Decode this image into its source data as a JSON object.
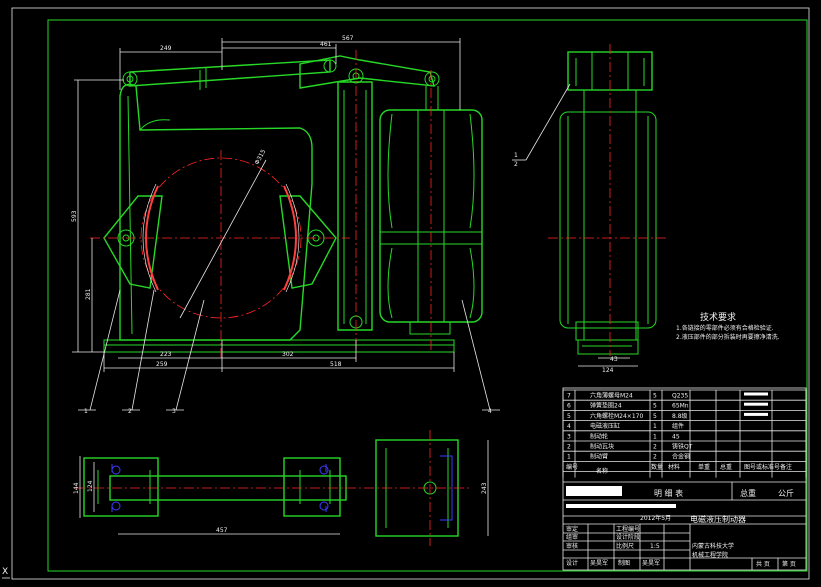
{
  "dimensions": {
    "d249": "249",
    "d461": "461",
    "d567": "567",
    "d593": "593",
    "d281": "281",
    "d223": "223",
    "d302": "302",
    "d259": "259",
    "d518": "518",
    "d315": "Φ315",
    "d43": "43",
    "d124": "124",
    "d144": "144",
    "d124b": "124",
    "d457": "457",
    "d243": "243"
  },
  "leaders": {
    "l1": "1",
    "l2": "2",
    "l3": "3",
    "l4": "4",
    "side_top": "1",
    "side_bot": "2"
  },
  "tech": {
    "title": "技术要求",
    "line1": "1.各链接的零部件必须有合格检验证.",
    "line2": "2.液压部件的部分拆装时再要擦净清洗."
  },
  "bom": [
    {
      "no": "7",
      "name": "六角薄螺母M24",
      "qty": "5",
      "material": "Q235",
      "weight": "",
      "std": "",
      "note": ""
    },
    {
      "no": "6",
      "name": "弹簧垫圈24",
      "qty": "5",
      "material": "65Mn",
      "weight": "",
      "std": "",
      "note": ""
    },
    {
      "no": "5",
      "name": "六角螺栓M24×170",
      "qty": "5",
      "material": "8.8级",
      "weight": "",
      "std": "",
      "note": ""
    },
    {
      "no": "4",
      "name": "电磁液压缸",
      "qty": "1",
      "material": "组件",
      "weight": "",
      "std": "",
      "note": ""
    },
    {
      "no": "3",
      "name": "制动轮",
      "qty": "1",
      "material": "45",
      "weight": "",
      "std": "",
      "note": ""
    },
    {
      "no": "2",
      "name": "制动瓦块",
      "qty": "2",
      "material": "铸铁QT",
      "weight": "",
      "std": "",
      "note": ""
    },
    {
      "no": "1",
      "name": "制动臂",
      "qty": "2",
      "material": "合金钢",
      "weight": "",
      "std": "",
      "note": ""
    }
  ],
  "bom_header": {
    "no": "编号",
    "name": "名称",
    "qty": "数量",
    "material": "材料",
    "weight": "单重",
    "total": "总重",
    "std": "图号或标准号",
    "note": "备注"
  },
  "title_block": {
    "list_title": "明 细 表",
    "total_weight": "总重",
    "unit": "公斤",
    "drawing_title": "电磁液压制动器",
    "date": "2012年5月",
    "school": "内蒙古科技大学",
    "college": "机械工程学院",
    "labels": {
      "stage": "工程编号",
      "design_stage": "设计阶段",
      "scale_label": "比例尺",
      "scale": "1:5",
      "sheet_total": "共 页",
      "sheet": "第 页",
      "role1": "审定",
      "role2": "组审",
      "role3": "审核",
      "role4": "设计",
      "role5": "制图",
      "name_a": "吴昊军",
      "name_b": "吴昊军"
    }
  },
  "ucs": "X"
}
